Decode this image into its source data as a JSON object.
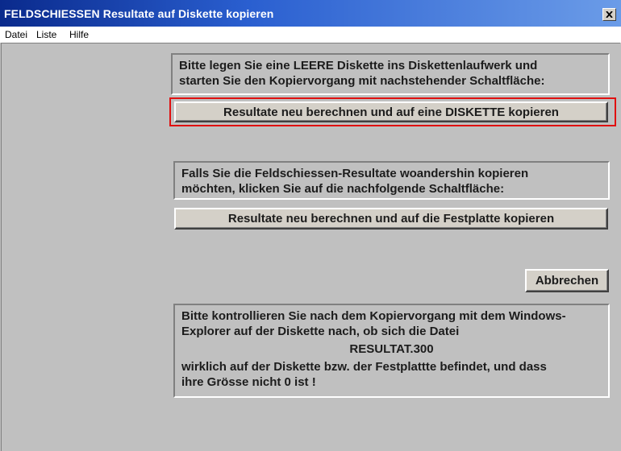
{
  "window": {
    "title": "FELDSCHIESSEN  Resultate auf Diskette kopieren",
    "close_glyph": "✕"
  },
  "menu": {
    "items": [
      "Datei",
      "Liste",
      "Hilfe"
    ]
  },
  "section_diskette": {
    "instruction_line1": "Bitte legen Sie eine LEERE Diskette ins Diskettenlaufwerk und",
    "instruction_line2": "starten Sie den Kopiervorgang mit nachstehender Schaltfläche:",
    "button_label": "Resultate neu berechnen und auf eine DISKETTE kopieren"
  },
  "section_festplatte": {
    "instruction_line1": "Falls Sie die Feldschiessen-Resultate woandershin kopieren",
    "instruction_line2": "möchten, klicken Sie auf die nachfolgende Schaltfläche:",
    "button_label": "Resultate neu berechnen und auf die Festplatte kopieren"
  },
  "cancel_button": {
    "label": "Abbrechen"
  },
  "note": {
    "line1": "Bitte kontrollieren Sie nach dem Kopiervorgang mit dem Windows-",
    "line2": "Explorer auf der Diskette nach, ob sich die Datei",
    "filename": "RESULTAT.300",
    "line3": "wirklich auf der Diskette bzw. der Festplattte befindet, und dass",
    "line4": "ihre Grösse nicht 0 ist !"
  },
  "colors": {
    "highlight": "#e01010",
    "titlebar_start": "#0a2a8c",
    "titlebar_end": "#6b9ce8"
  }
}
